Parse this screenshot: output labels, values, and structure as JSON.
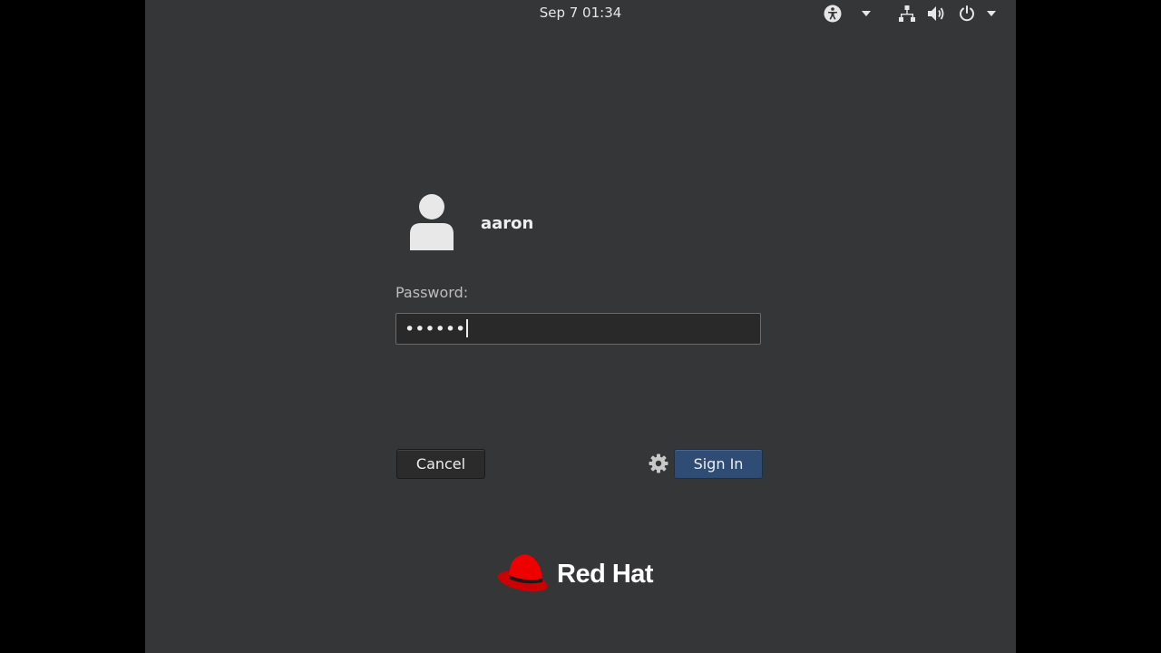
{
  "topbar": {
    "clock": "Sep 7  01:34",
    "icons": [
      "accessibility-icon",
      "network-icon",
      "volume-icon",
      "power-icon"
    ]
  },
  "login": {
    "username": "aaron",
    "password_label": "Password:",
    "password_masked": "••••••",
    "cancel_label": "Cancel",
    "signin_label": "Sign In",
    "session_icon": "gear-icon"
  },
  "brand": {
    "name": "Red Hat",
    "logo_color": "#ee0000"
  },
  "colors": {
    "background": "#353638",
    "signin_button": "#2e4c74"
  }
}
